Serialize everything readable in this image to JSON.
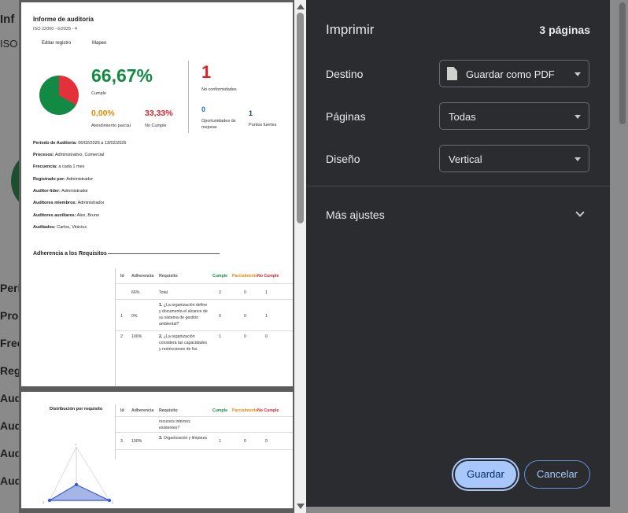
{
  "background": {
    "fragments": [
      "Inf",
      "ISO",
      "Peri",
      "Proc",
      "Frec",
      "Reg",
      "Aud",
      "Aud",
      "Aud",
      "Aud"
    ]
  },
  "report": {
    "title": "Informe de auditoría",
    "subtitle": "ISO 22000 - 6/2025 - 4",
    "buttons": [
      "Editar registro",
      "Mapeo"
    ],
    "compliance_pct": "66,67%",
    "compliance_label": "Cumple",
    "partial_pct": "0,00%",
    "partial_label": "Atendimiento parcial",
    "noncompliance_pct": "33,33%",
    "noncompliance_label": "No Cumple",
    "nonconformities_count": "1",
    "nonconformities_label": "No conformidades",
    "opportunities_count": "0",
    "opportunities_label": "Oportunidades de mejoras",
    "strengths_count": "1",
    "strengths_label": "Puntos fuertes",
    "pie": {
      "cumple": 66.67,
      "no_cumple": 33.33,
      "parcial": 0
    },
    "info": [
      {
        "label": "Período de Auditoría:",
        "value": "06/02/2026 a 13/02/2026"
      },
      {
        "label": "Procesos:",
        "value": "Administrativo, Comercial"
      },
      {
        "label": "Frecuencia:",
        "value": "a cada 1 mes"
      },
      {
        "label": "Registrado por:",
        "value": "Administrador"
      },
      {
        "label": "Auditor-líder:",
        "value": "Administrador"
      },
      {
        "label": "Auditores miembros:",
        "value": "Administrador"
      },
      {
        "label": "Auditores auxiliares:",
        "value": "Alex, Bruno"
      },
      {
        "label": "Auditados:",
        "value": "Carlos, Vinicius"
      }
    ],
    "adherence_title": "Adherencia a los Requisitos",
    "table": {
      "headers": [
        "Id",
        "Adherencia",
        "Requisito",
        "Cumple",
        "Parcialmente",
        "No Cumple"
      ],
      "rows": [
        {
          "id": "",
          "adherence": "66%",
          "req_num": "",
          "req_text": "Total",
          "cumple": "2",
          "parcial": "0",
          "no": "1"
        },
        {
          "id": "1",
          "adherence": "0%",
          "req_num": "1.",
          "req_text": "¿La organización define y documenta el alcance de su sistema de gestión ambiental?",
          "cumple": "0",
          "parcial": "0",
          "no": "1"
        },
        {
          "id": "2",
          "adherence": "100%",
          "req_num": "2.",
          "req_text": "¿La organización considera las capacidades y restricciones de los",
          "cumple": "1",
          "parcial": "0",
          "no": "0"
        }
      ]
    },
    "page2": {
      "radar_title": "Distribución por requisito",
      "radar_ticks": [
        "1",
        "3",
        "2"
      ],
      "cont_text": "recursos internos existentes?",
      "row3": {
        "id": "3",
        "adherence": "100%",
        "req_num": "3.",
        "req_text": "Organización y limpieza",
        "cumple": "1",
        "parcial": "0",
        "no": "0"
      }
    }
  },
  "print_dialog": {
    "title": "Imprimir",
    "pages_count": "3 páginas",
    "destination_label": "Destino",
    "destination_value": "Guardar como PDF",
    "pages_label": "Páginas",
    "pages_value": "Todas",
    "layout_label": "Diseño",
    "layout_value": "Vertical",
    "more_settings": "Más ajustes",
    "save_button": "Guardar",
    "cancel_button": "Cancelar"
  },
  "colors": {
    "green": "#138a44",
    "red": "#d9232d",
    "orange": "#e08a00",
    "blue": "#1a6fb0",
    "dialog_bg": "#2b2c30",
    "primary": "#a8c7fa"
  }
}
